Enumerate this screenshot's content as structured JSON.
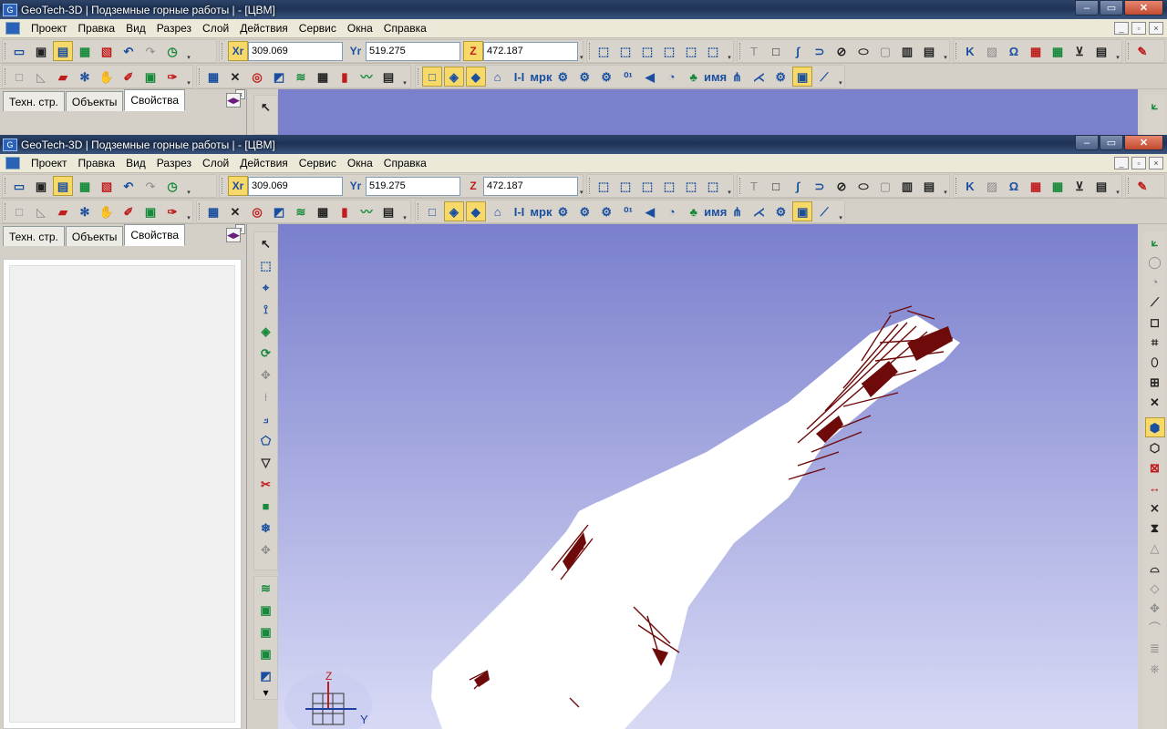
{
  "window": {
    "title": "GeoTech-3D | Подземные горные работы | - [ЦВМ]",
    "app_icon": "geotech-app-icon",
    "controls": {
      "minimize": "‒",
      "maximize": "▭",
      "close": "✕"
    }
  },
  "menu": {
    "items": [
      "Проект",
      "Правка",
      "Вид",
      "Разрез",
      "Слой",
      "Действия",
      "Сервис",
      "Окна",
      "Справка"
    ],
    "mdi_controls": [
      "_",
      "▫",
      "×"
    ]
  },
  "coords": {
    "x_label": "Xr",
    "x_value": "309.069",
    "y_label": "Yr",
    "y_value": "519.275",
    "z_label": "Z",
    "z_value": "472.187"
  },
  "panel": {
    "tabs": [
      "Техн. стр.",
      "Объекты",
      "Свойства"
    ],
    "active_tab": 2,
    "nav_glyph": "◀▶",
    "close_glyph": "×"
  },
  "view3d": {
    "axis_z": "Z",
    "axis_y": "Y",
    "colors": {
      "bg_top": "#7a7fcd",
      "bg_bottom": "#d8daf5",
      "model_fill": "#ffffff",
      "model_detail": "#6e0a0a",
      "titlebar_blue": "#1e3356"
    }
  },
  "toolbars": {
    "file_icons": [
      "open-folder-icon",
      "save-icon",
      "layers-icon",
      "cube-tools-icon",
      "box-edit-icon",
      "undo-icon",
      "redo-icon",
      "clock-icon"
    ],
    "view_icons": [
      "view-cube-1-icon",
      "view-cube-2-icon",
      "view-cube-3-icon",
      "view-cube-4-icon",
      "view-cube-5-icon",
      "view-cube-6-icon"
    ],
    "draw_icons": [
      "text-tool-icon",
      "rectangle-icon",
      "polyline-icon",
      "arc-icon",
      "circle-icon",
      "ellipse-icon",
      "frame-icon",
      "stamp-icon",
      "document-icon"
    ],
    "misc_icons": [
      "k-tool-icon",
      "hatch-icon",
      "omega-icon",
      "palette-icon",
      "grid-icon",
      "measure-icon",
      "table-icon",
      "pen-icon"
    ]
  }
}
